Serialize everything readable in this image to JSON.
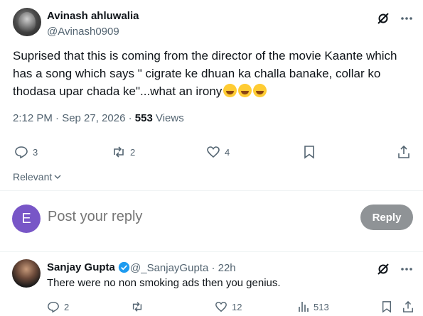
{
  "tweet": {
    "author_name": "Avinash ahluwalia",
    "author_handle": "@Avinash0909",
    "text": "Suprised that this is coming from the director of the movie Kaante which has a song  which says \" cigrate ke dhuan ka challa banake, collar ko thodasa upar chada ke\"...what an irony",
    "timestamp": "2:12 PM · Sep 27, 2026 · ",
    "views_count": "553",
    "views_label": " Views",
    "replies": "3",
    "reposts": "2",
    "likes": "4",
    "emojis": [
      "grinning-squinting-face",
      "grinning-squinting-face",
      "grinning-face-with-big-eyes"
    ]
  },
  "sort": {
    "label": "Relevant"
  },
  "composer": {
    "avatar_letter": "E",
    "placeholder": "Post your reply",
    "button_label": "Reply"
  },
  "reply": {
    "author_name": "Sanjay Gupta",
    "author_handle": "@_SanjayGupta · 22h",
    "text": "There were no non smoking ads then you genius.",
    "replies": "2",
    "reposts": "",
    "likes": "12",
    "views": "513"
  },
  "colors": {
    "text": "#0f1419",
    "muted": "#536471",
    "verified": "#1d9bf0",
    "composer_avatar": "#7856c7",
    "reply_button": "#8f9396"
  }
}
